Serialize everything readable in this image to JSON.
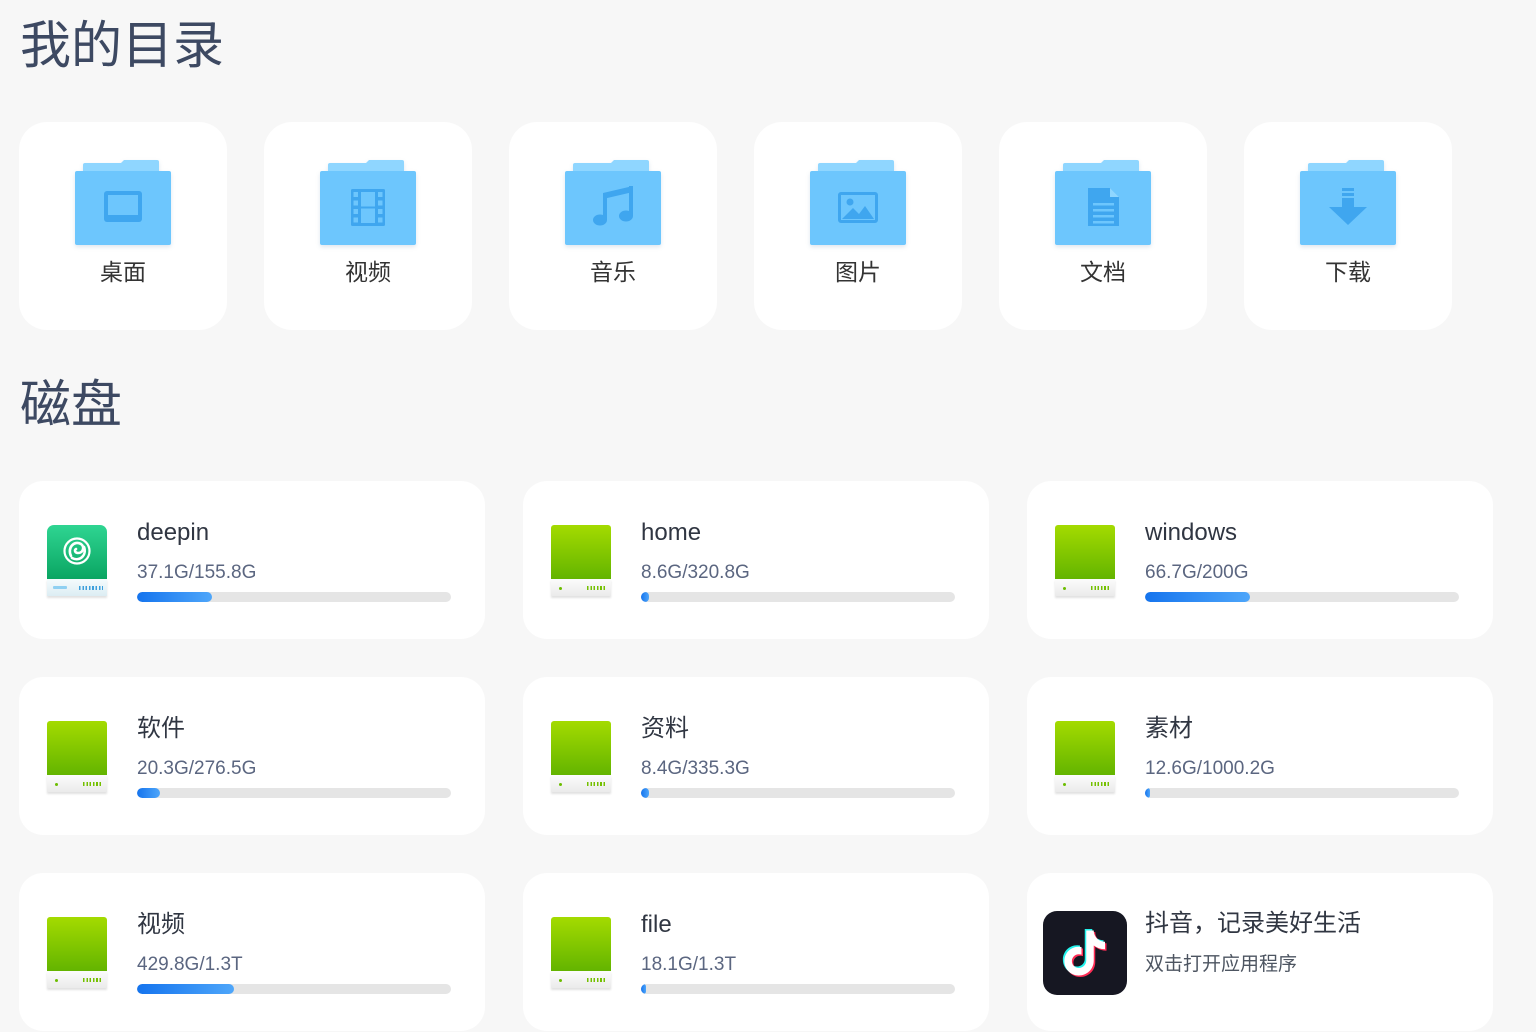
{
  "my_directory": {
    "title": "我的目录",
    "folders": [
      {
        "label": "桌面",
        "icon": "desktop-folder-icon"
      },
      {
        "label": "视频",
        "icon": "video-folder-icon"
      },
      {
        "label": "音乐",
        "icon": "music-folder-icon"
      },
      {
        "label": "图片",
        "icon": "pictures-folder-icon"
      },
      {
        "label": "文档",
        "icon": "documents-folder-icon"
      },
      {
        "label": "下载",
        "icon": "downloads-folder-icon"
      }
    ]
  },
  "disks": {
    "title": "磁盘",
    "items": [
      {
        "name": "deepin",
        "usage": "37.1G/155.8G",
        "used_fraction": 0.238,
        "icon": "deepin-drive-icon"
      },
      {
        "name": "home",
        "usage": "8.6G/320.8G",
        "used_fraction": 0.027,
        "icon": "drive-icon"
      },
      {
        "name": "windows",
        "usage": "66.7G/200G",
        "used_fraction": 0.334,
        "icon": "drive-icon"
      },
      {
        "name": "软件",
        "usage": "20.3G/276.5G",
        "used_fraction": 0.073,
        "icon": "drive-icon"
      },
      {
        "name": "资料",
        "usage": "8.4G/335.3G",
        "used_fraction": 0.025,
        "icon": "drive-icon"
      },
      {
        "name": "素材",
        "usage": "12.6G/1000.2G",
        "used_fraction": 0.013,
        "icon": "drive-icon"
      },
      {
        "name": "视频",
        "usage": "429.8G/1.3T",
        "used_fraction": 0.31,
        "icon": "drive-icon"
      },
      {
        "name": "file",
        "usage": "18.1G/1.3T",
        "used_fraction": 0.014,
        "icon": "drive-icon"
      }
    ],
    "app": {
      "name": "抖音，记录美好生活",
      "hint": "双击打开应用程序",
      "icon": "tiktok-icon"
    }
  },
  "colors": {
    "page_background": "#f7f7f7",
    "card_background": "#ffffff",
    "title_color": "#3d4962",
    "folder_body": "#6dc6fd",
    "folder_tab": "#8fd6ff",
    "folder_glyph": "#3fa6ef",
    "progress_track": "#e5e5e5",
    "progress_fill_start": "#1574ee",
    "progress_fill_end": "#4ea6fa",
    "drive_green_top": "#a4db00",
    "drive_green_bottom": "#63b400"
  }
}
